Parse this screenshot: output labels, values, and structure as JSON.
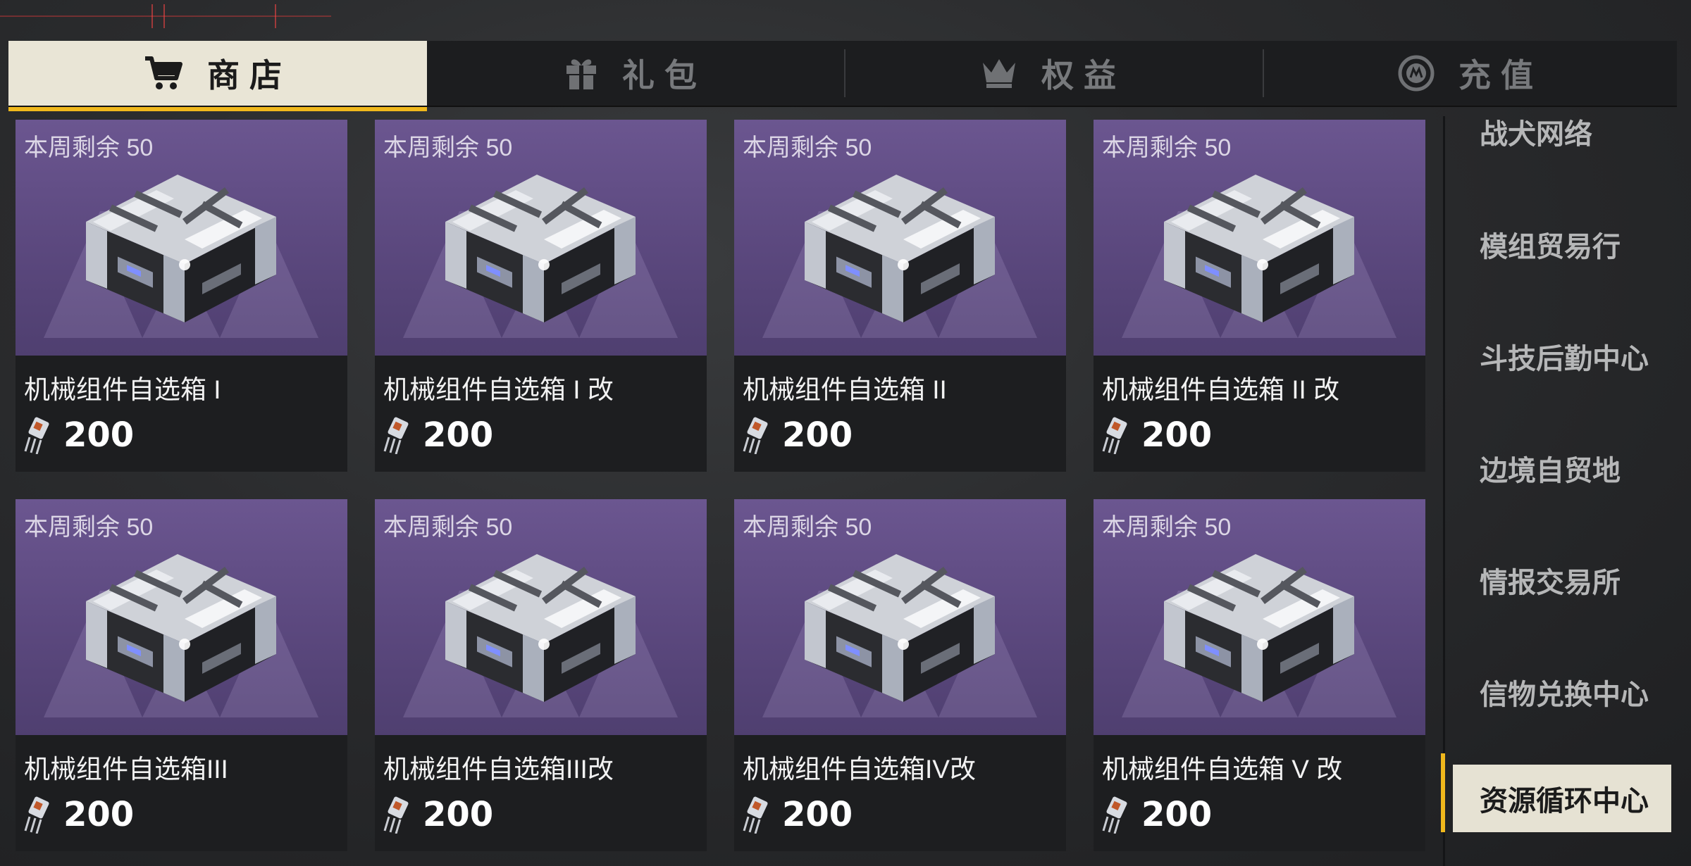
{
  "tabs": [
    {
      "label": "商店",
      "icon": "cart-icon",
      "active": true
    },
    {
      "label": "礼包",
      "icon": "gift-icon",
      "active": false
    },
    {
      "label": "权益",
      "icon": "crown-icon",
      "active": false
    },
    {
      "label": "充值",
      "icon": "coin-icon",
      "active": false
    }
  ],
  "items": [
    {
      "remaining": "本周剩余 50",
      "name": "机械组件自选箱 I",
      "price": "200"
    },
    {
      "remaining": "本周剩余 50",
      "name": "机械组件自选箱 I 改",
      "price": "200"
    },
    {
      "remaining": "本周剩余 50",
      "name": "机械组件自选箱 II",
      "price": "200"
    },
    {
      "remaining": "本周剩余 50",
      "name": "机械组件自选箱 II 改",
      "price": "200"
    },
    {
      "remaining": "本周剩余 50",
      "name": "机械组件自选箱III",
      "price": "200"
    },
    {
      "remaining": "本周剩余 50",
      "name": "机械组件自选箱III改",
      "price": "200"
    },
    {
      "remaining": "本周剩余 50",
      "name": "机械组件自选箱IV改",
      "price": "200"
    },
    {
      "remaining": "本周剩余 50",
      "name": "机械组件自选箱 V 改",
      "price": "200"
    }
  ],
  "currency_icon": "component-chip-icon",
  "sidebar": {
    "items": [
      {
        "label": "战犬网络"
      },
      {
        "label": "模组贸易行"
      },
      {
        "label": "斗技后勤中心"
      },
      {
        "label": "边境自贸地"
      },
      {
        "label": "情报交易所"
      },
      {
        "label": "信物兑换中心"
      },
      {
        "label": "资源循环中心",
        "active": true
      }
    ]
  },
  "colors": {
    "accent": "#f0b81c",
    "active_tab_bg": "#e9e5d6",
    "card_image_bg": "#5b487e"
  }
}
